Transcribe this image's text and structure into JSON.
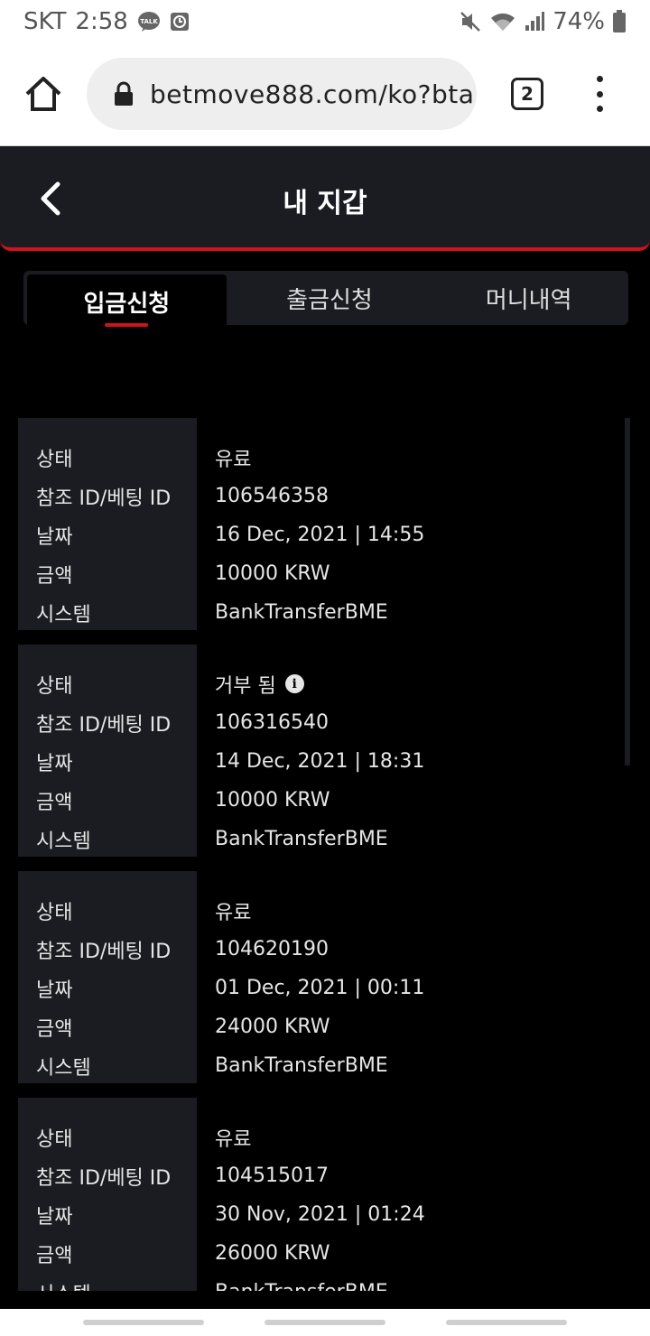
{
  "status_bar": {
    "carrier": "SKT",
    "time": "2:58",
    "battery": "74%"
  },
  "browser": {
    "url": "betmove888.com/ko?bta",
    "tab_count": "2"
  },
  "header": {
    "title": "내 지갑"
  },
  "tabs": [
    {
      "label": "입금신청"
    },
    {
      "label": "출금신청"
    },
    {
      "label": "머니내역"
    }
  ],
  "field_labels": {
    "status": "상태",
    "ref_id": "참조 ID/베팅 ID",
    "date": "날짜",
    "amount": "금액",
    "system": "시스템"
  },
  "records": [
    {
      "status": "유료",
      "ref_id": "106546358",
      "date": "16 Dec, 2021 | 14:55",
      "amount": "10000 KRW",
      "system": "BankTransferBME"
    },
    {
      "status": "거부 됨",
      "ref_id": "106316540",
      "date": "14 Dec, 2021 | 18:31",
      "amount": "10000 KRW",
      "system": "BankTransferBME"
    },
    {
      "status": "유료",
      "ref_id": "104620190",
      "date": "01 Dec, 2021 | 00:11",
      "amount": "24000 KRW",
      "system": "BankTransferBME"
    },
    {
      "status": "유료",
      "ref_id": "104515017",
      "date": "30 Nov, 2021 | 01:24",
      "amount": "26000 KRW",
      "system": "BankTransferBME"
    }
  ],
  "info_icon_glyph": "i"
}
